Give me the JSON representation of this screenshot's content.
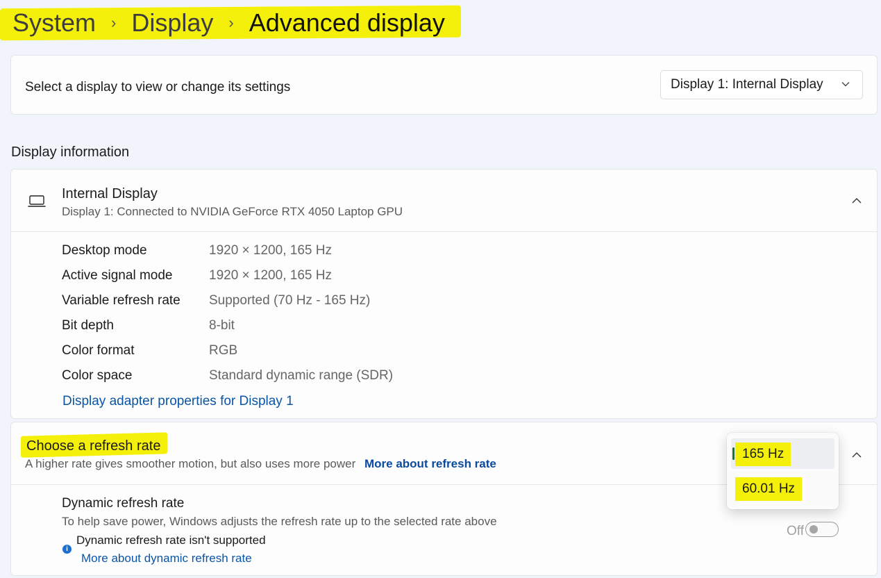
{
  "breadcrumb": {
    "items": [
      "System",
      "Display",
      "Advanced display"
    ],
    "separator": "›"
  },
  "display_select": {
    "label": "Select a display to view or change its settings",
    "value": "Display 1: Internal Display",
    "chevron": "⌄"
  },
  "section_title": "Display information",
  "display_info": {
    "name": "Internal Display",
    "subtitle": "Display 1: Connected to NVIDIA GeForce RTX 4050 Laptop GPU",
    "properties": [
      {
        "label": "Desktop mode",
        "value": "1920 × 1200, 165 Hz"
      },
      {
        "label": "Active signal mode",
        "value": "1920 × 1200, 165 Hz"
      },
      {
        "label": "Variable refresh rate",
        "value": "Supported (70 Hz - 165 Hz)"
      },
      {
        "label": "Bit depth",
        "value": "8-bit"
      },
      {
        "label": "Color format",
        "value": "RGB"
      },
      {
        "label": "Color space",
        "value": "Standard dynamic range (SDR)"
      }
    ],
    "adapter_link": "Display adapter properties for Display 1"
  },
  "refresh_rate": {
    "title": "Choose a refresh rate",
    "subtitle": "A higher rate gives smoother motion, but also uses more power",
    "more_link": "More about refresh rate",
    "options": [
      "165 Hz",
      "60.01 Hz"
    ],
    "selected": "165 Hz"
  },
  "dynamic_refresh": {
    "title": "Dynamic refresh rate",
    "subtitle": "To help save power, Windows adjusts the refresh rate up to the selected rate above",
    "warning": "Dynamic refresh rate isn't supported",
    "more_link": "More about dynamic refresh rate",
    "toggle_state": "Off"
  },
  "colors": {
    "highlight": "#f4f00a",
    "link": "#0a55a5",
    "selection_indicator": "#0e7a2b"
  },
  "icons": {
    "display": "laptop-icon",
    "info": "info-icon",
    "expand": "chevron-up-icon",
    "dropdown": "chevron-down-icon"
  }
}
